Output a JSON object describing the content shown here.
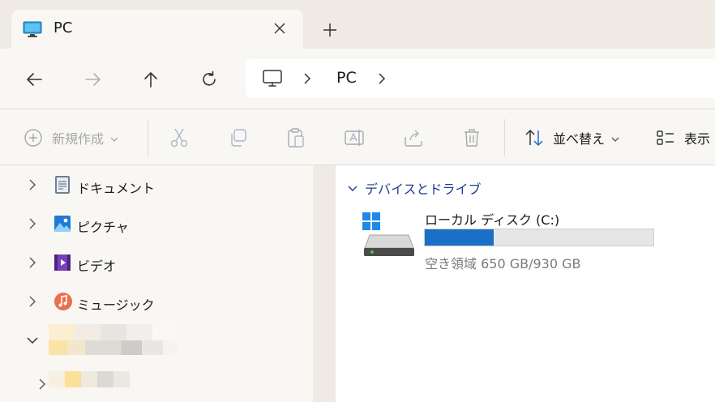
{
  "tab": {
    "title": "PC"
  },
  "address": {
    "crumb": "PC"
  },
  "commands": {
    "new": "新規作成",
    "sort": "並べ替え",
    "view": "表示"
  },
  "sidebar": {
    "items": [
      {
        "label": "ドキュメント",
        "icon": "documents-icon"
      },
      {
        "label": "ピクチャ",
        "icon": "pictures-icon"
      },
      {
        "label": "ビデオ",
        "icon": "videos-icon"
      },
      {
        "label": "ミュージック",
        "icon": "music-icon"
      }
    ]
  },
  "main": {
    "group_label": "デバイスとドライブ",
    "drives": [
      {
        "name": "ローカル ディスク (C:)",
        "space_text": "空き領域 650 GB/930 GB",
        "used_fraction": 0.3
      }
    ]
  },
  "colors": {
    "accent": "#1a6fc7",
    "group_header": "#1b3f8f",
    "window_bg": "#efeae4"
  }
}
